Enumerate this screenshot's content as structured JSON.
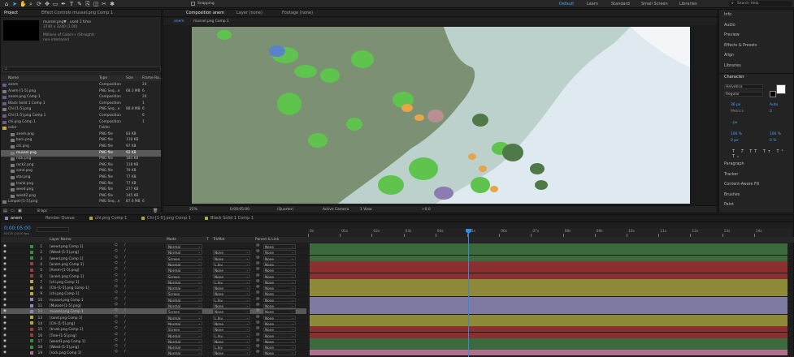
{
  "colors": {
    "accent": "#4aa3ff",
    "playhead": "#2d8ceb",
    "timecode": "#3f9cff",
    "barRed": "#8a3030",
    "barYellow": "#8f8a3a",
    "barGreen": "#3c6a3c",
    "barLavender": "#7f7aa2",
    "barPink": "#b06f8e"
  },
  "toolbar": {
    "icons": [
      "home-icon",
      "selection-tool-icon",
      "hand-tool-icon",
      "zoom-tool-icon",
      "orbit-tool-icon",
      "pan-behind-icon",
      "rectangle-tool-icon",
      "pen-tool-icon",
      "type-tool-icon",
      "brush-tool-icon",
      "clone-stamp-icon",
      "eraser-tool-icon",
      "roto-brush-icon",
      "puppet-tool-icon"
    ],
    "snapping_label": "Snapping",
    "workspaces": [
      "Default",
      "Learn",
      "Standard",
      "Small Screen",
      "Libraries"
    ],
    "search_placeholder": "Search Help"
  },
  "project": {
    "tabs": [
      "Project",
      "Effect Controls mussel.png Comp 1"
    ],
    "preview_name": "mussel.png▼ , used 1 time",
    "preview_dims": "3740 x 3240 (1.00)",
    "preview_colors": "Millions of Colors+ (Straight)",
    "preview_interlace": "non-interlaced",
    "columns": {
      "name": "Name",
      "type": "Type",
      "size": "Size",
      "frame_rate": "Frame Ra..."
    },
    "items": [
      {
        "name": "anem",
        "type": "Composition",
        "size": "",
        "fr": "24",
        "icon": "#6a5a8a"
      },
      {
        "name": "Anem-[1-5].png",
        "type": "PNG Seq...e",
        "size": "68.3 MB",
        "fr": "6",
        "icon": "#7a7a7a"
      },
      {
        "name": "anem.png Comp 1",
        "type": "Composition",
        "size": "",
        "fr": "24",
        "icon": "#6a5a8a"
      },
      {
        "name": "Black Solid 1 Comp 1",
        "type": "Composition",
        "size": "",
        "fr": "1",
        "icon": "#6a5a8a"
      },
      {
        "name": "Chi-[1-5].png",
        "type": "PNG Seq...e",
        "size": "88.9 MB",
        "fr": "6",
        "icon": "#7a7a7a"
      },
      {
        "name": "Chi-[1-5].png Comp 1",
        "type": "Composition",
        "size": "",
        "fr": "6",
        "icon": "#6a5a8a"
      },
      {
        "name": "chi.png Comp 1",
        "type": "Composition",
        "size": "",
        "fr": "1",
        "icon": "#6a5a8a"
      },
      {
        "name": "color",
        "type": "Folder",
        "size": "",
        "fr": "",
        "icon": "#c8a83a"
      },
      {
        "name": "anem.png",
        "type": "PNG file",
        "size": "83 KB",
        "fr": "",
        "icon": "#7a7a7a"
      },
      {
        "name": "barn.png",
        "type": "PNG file",
        "size": "118 KB",
        "fr": "",
        "icon": "#7a7a7a"
      },
      {
        "name": "chi.png",
        "type": "PNG file",
        "size": "97 KB",
        "fr": "",
        "icon": "#7a7a7a"
      },
      {
        "name": "mussel.png",
        "type": "PNG file",
        "size": "92 KB",
        "fr": "",
        "icon": "#7a7a7a",
        "selected": true
      },
      {
        "name": "nick.png",
        "type": "PNG file",
        "size": "184 KB",
        "fr": "",
        "icon": "#7a7a7a"
      },
      {
        "name": "rock2.png",
        "type": "PNG file",
        "size": "118 KB",
        "fr": "",
        "icon": "#7a7a7a"
      },
      {
        "name": "sand.png",
        "type": "PNG file",
        "size": "79 KB",
        "fr": "",
        "icon": "#7a7a7a"
      },
      {
        "name": "star.png",
        "type": "PNG file",
        "size": "77 KB",
        "fr": "",
        "icon": "#7a7a7a"
      },
      {
        "name": "trunk.png",
        "type": "PNG file",
        "size": "77 KB",
        "fr": "",
        "icon": "#7a7a7a"
      },
      {
        "name": "weed.png",
        "type": "PNG file",
        "size": "277 KB",
        "fr": "",
        "icon": "#7a7a7a"
      },
      {
        "name": "weed2.png",
        "type": "PNG file",
        "size": "145 KB",
        "fr": "",
        "icon": "#7a7a7a"
      },
      {
        "name": "Limpet-[1-5].png",
        "type": "PNG Seq...e",
        "size": "87.6 MB",
        "fr": "6",
        "icon": "#7a7a7a"
      }
    ],
    "bpc": "8 bpc"
  },
  "composition": {
    "tabs": [
      "Composition anem",
      "Layer (none)",
      "Footage (none)"
    ],
    "subtabs": [
      "anem",
      "mussel.png Comp 1"
    ],
    "footer": {
      "zoom": "25%",
      "timecode": "0:00:05:00",
      "resolution": "(Quarter)",
      "camera": "Active Camera",
      "view": "1 View",
      "exposure": "+0.0"
    }
  },
  "right_panel": {
    "top_items": [
      "Info",
      "Audio",
      "Preview",
      "Effects & Presets",
      "Align",
      "Libraries"
    ],
    "character": {
      "title": "Character",
      "font": "Helvetica",
      "style": "Regular",
      "size": "36 px",
      "leading": "Auto",
      "kerning": "Metrics",
      "tracking": "0",
      "stroke": "- px",
      "vscale": "100 %",
      "hscale": "100 %",
      "baseline": "0 px",
      "tsume": "0 %"
    },
    "bottom_items": [
      "Paragraph",
      "Tracker",
      "Content-Aware Fill",
      "Brushes",
      "Paint"
    ]
  },
  "timeline": {
    "tabs": [
      "anem",
      "Render Queue",
      "chi.png Comp 1",
      "Chi-[1-5].png Comp 1",
      "Black Solid 1 Comp 1"
    ],
    "timecode": "0:00:05:00",
    "fps_note": "00120 (24.00 fps)",
    "headers": {
      "name": "Layer Name",
      "mode": "Mode",
      "t": "T",
      "trkmat": "TrkMat",
      "parent": "Parent & Link"
    },
    "ruler": [
      "0s",
      "01s",
      "02s",
      "03s",
      "04s",
      "05s",
      "06s",
      "07s",
      "08s",
      "09s",
      "10s",
      "11s",
      "12s",
      "13s",
      "14s"
    ],
    "layers": [
      {
        "n": "1",
        "name": "[weed.png Comp 1]",
        "mode": "Normal",
        "trk": "",
        "par": "None",
        "lc": "#3c8a3c",
        "bar": "barGreen"
      },
      {
        "n": "2",
        "name": "[Weed-[1-5].png]",
        "mode": "Normal",
        "trk": "None",
        "par": "None",
        "lc": "#3c8a3c",
        "bar": "barGreen"
      },
      {
        "n": "3",
        "name": "[weed.png Comp 1]",
        "mode": "Screen",
        "trk": "None",
        "par": "None",
        "lc": "#3c8a3c",
        "bar": "barGreen"
      },
      {
        "n": "4",
        "name": "[anem.png Comp 1]",
        "mode": "Normal",
        "trk": "L.Inv",
        "par": "None",
        "lc": "#a03a3a",
        "bar": "barRed"
      },
      {
        "n": "5",
        "name": "[Anem-[1-5].png]",
        "mode": "Normal",
        "trk": "None",
        "par": "None",
        "lc": "#a03a3a",
        "bar": "barRed"
      },
      {
        "n": "6",
        "name": "[anem.png Comp 1]",
        "mode": "Screen",
        "trk": "None",
        "par": "None",
        "lc": "#a03a3a",
        "bar": "barRed"
      },
      {
        "n": "7",
        "name": "[chi.png Comp 1]",
        "mode": "Normal",
        "trk": "L.Inv",
        "par": "None",
        "lc": "#b0a83a",
        "bar": "barYellow"
      },
      {
        "n": "8",
        "name": "[Chi-[1-5].png Comp 1]",
        "mode": "Normal",
        "trk": "None",
        "par": "None",
        "lc": "#b0a83a",
        "bar": "barYellow"
      },
      {
        "n": "9",
        "name": "[chi.png Comp 1]",
        "mode": "Screen",
        "trk": "None",
        "par": "None",
        "lc": "#b0a83a",
        "bar": "barYellow"
      },
      {
        "n": "10",
        "name": "mussel.png Comp 1",
        "mode": "Normal",
        "trk": "L.Inv",
        "par": "None",
        "lc": "#8a86b5",
        "bar": "barLavender"
      },
      {
        "n": "11",
        "name": "[Mussel-[1-5].png]",
        "mode": "Normal",
        "trk": "None",
        "par": "None",
        "lc": "#8a86b5",
        "bar": "barLavender"
      },
      {
        "n": "12",
        "name": "mussel.png Comp 1",
        "mode": "Screen",
        "trk": "None",
        "par": "None",
        "lc": "#8a86b5",
        "bar": "barLavender",
        "selected": true
      },
      {
        "n": "13",
        "name": "[sand.png Comp 1]",
        "mode": "Normal",
        "trk": "L.Inv",
        "par": "None",
        "lc": "#b0a83a",
        "bar": "barYellow"
      },
      {
        "n": "14",
        "name": "[Chi-[1-5].png]",
        "mode": "Normal",
        "trk": "None",
        "par": "None",
        "lc": "#b0a83a",
        "bar": "barYellow"
      },
      {
        "n": "15",
        "name": "[trunk.png Comp 1]",
        "mode": "Screen",
        "trk": "None",
        "par": "None",
        "lc": "#a03a3a",
        "bar": "barRed"
      },
      {
        "n": "16",
        "name": "[Tree-[1-5].png]",
        "mode": "Normal",
        "trk": "L.Inv",
        "par": "None",
        "lc": "#a03a3a",
        "bar": "barRed"
      },
      {
        "n": "17",
        "name": "[weed3.png Comp 1]",
        "mode": "Normal",
        "trk": "None",
        "par": "None",
        "lc": "#3c8a3c",
        "bar": "barGreen"
      },
      {
        "n": "18",
        "name": "[Weed-[1-5].png]",
        "mode": "Normal",
        "trk": "L.Inv",
        "par": "None",
        "lc": "#3c8a3c",
        "bar": "barGreen"
      },
      {
        "n": "19",
        "name": "[rock.png Comp 1]",
        "mode": "Normal",
        "trk": "None",
        "par": "None",
        "lc": "#b06f8e",
        "bar": "barPink"
      }
    ]
  }
}
